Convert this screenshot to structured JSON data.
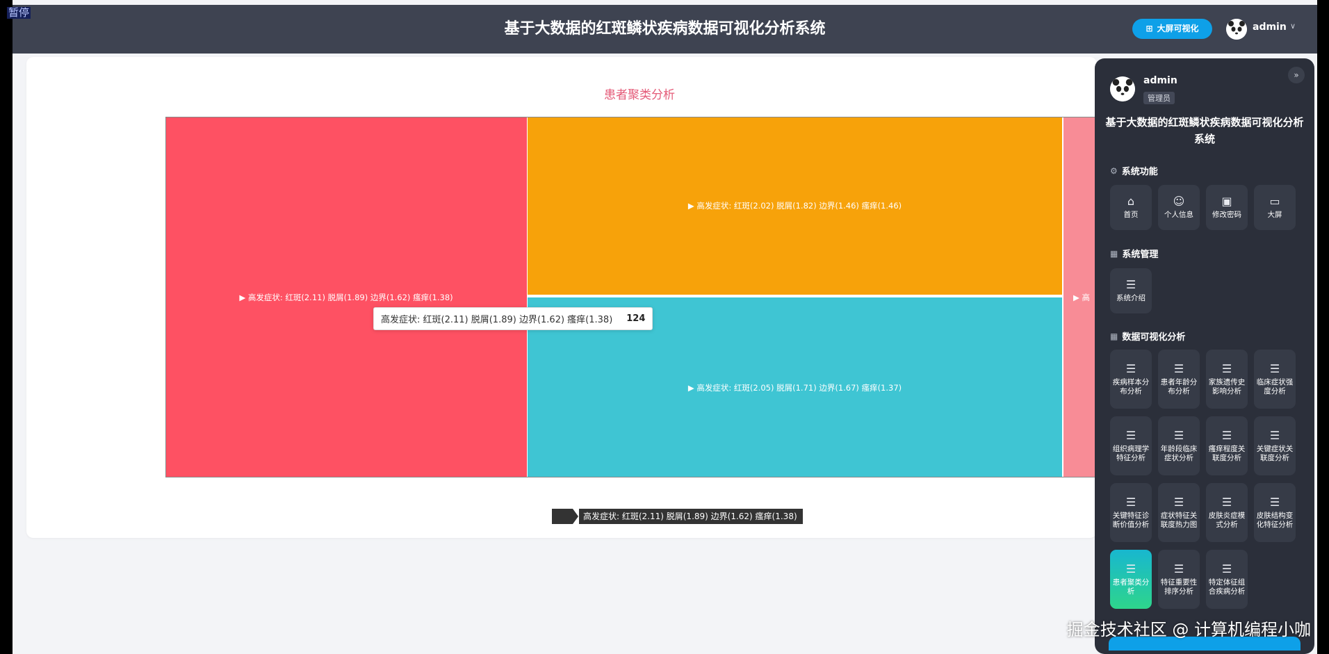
{
  "app": {
    "title": "基于大数据的红斑鳞状疾病数据可视化分析系统",
    "pause_label": "暂停"
  },
  "header": {
    "screen_button_label": "大屏可视化",
    "user_name": "admin"
  },
  "chart": {
    "title": "患者聚类分析",
    "tooltip_label": "高发症状: 红斑(2.11) 脱屑(1.89) 边界(1.62) 瘙痒(1.38)",
    "tooltip_value": "124",
    "breadcrumb": "高发症状: 红斑(2.11) 脱屑(1.89) 边界(1.62) 瘙痒(1.38)",
    "colors": {
      "cluster1": "#fe5163",
      "cluster2": "#f7a20a",
      "cluster3": "#3fc5d3",
      "cluster4": "#f88c96"
    }
  },
  "chart_data": {
    "type": "treemap",
    "title": "患者聚类分析",
    "nodes": [
      {
        "name": "▶ 高发症状: 红斑(2.11) 脱屑(1.89) 边界(1.62) 瘙痒(1.38)",
        "value": 124
      },
      {
        "name": "▶ 高发症状: 红斑(2.02) 脱屑(1.82) 边界(1.46) 瘙痒(1.46)"
      },
      {
        "name": "▶ 高发症状: 红斑(2.05) 脱屑(1.71) 边界(1.67) 瘙痒(1.37)"
      },
      {
        "name": "▶ 高"
      }
    ]
  },
  "panel": {
    "user_name": "admin",
    "role": "管理员",
    "title": "基于大数据的红斑鳞状疾病数据可视化分析系统",
    "sections": {
      "system_functions": "系统功能",
      "system_management": "系统管理",
      "data_analysis": "数据可视化分析"
    },
    "functions": {
      "home": "首页",
      "profile": "个人信息",
      "password": "修改密码",
      "screen": "大屏"
    },
    "management": {
      "intro": "系统介绍"
    },
    "analysis": {
      "a1": "疾病样本分布分析",
      "a2": "患者年龄分布分析",
      "a3": "家族遗传史影响分析",
      "a4": "临床症状强度分析",
      "a5": "组织病理学特征分析",
      "a6": "年龄段临床症状分析",
      "a7": "瘙痒程度关联度分析",
      "a8": "关键症状关联度分析",
      "a9": "关键特征诊断价值分析",
      "a10": "症状特征关联度热力图",
      "a11": "皮肤炎症模式分析",
      "a12": "皮肤结构变化特征分析",
      "a13": "患者聚类分析",
      "a14": "特征重要性排序分析",
      "a15": "特定体征组合疾病分析"
    }
  },
  "watermark": "掘金技术社区 @ 计算机编程小咖"
}
